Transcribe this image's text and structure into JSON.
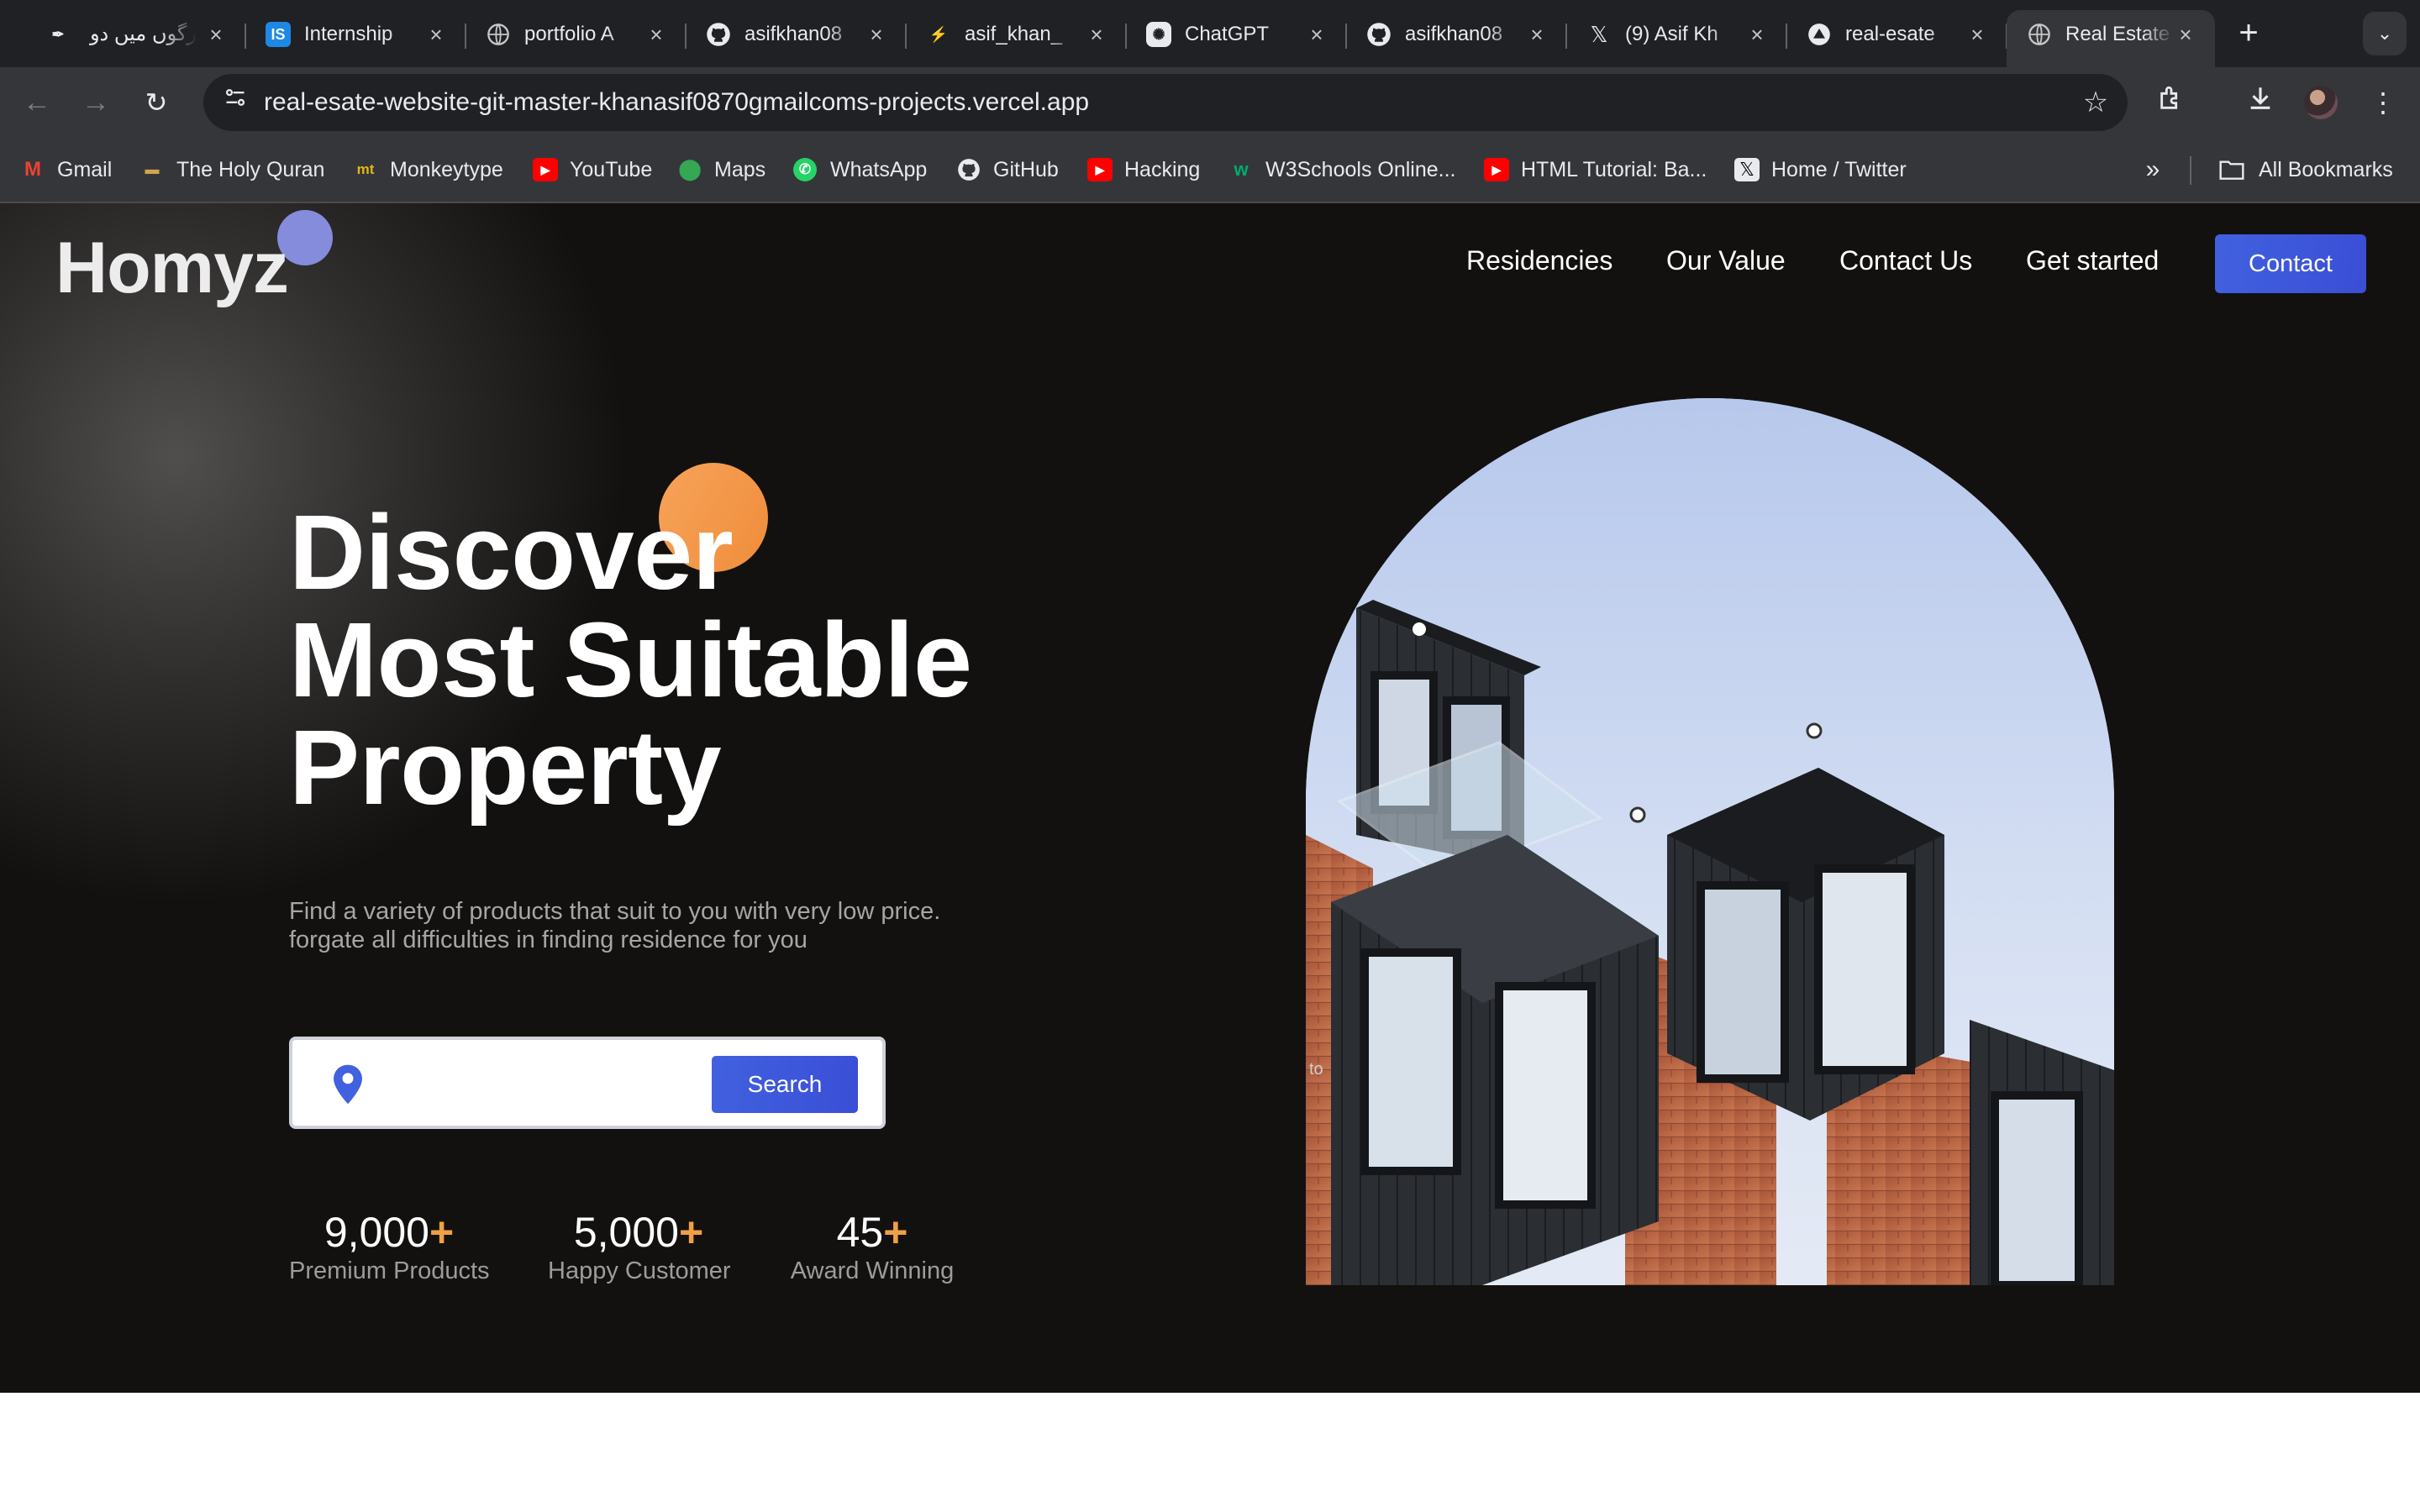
{
  "browser": {
    "tabs": [
      {
        "title": "رگوں میں دو",
        "icon": "pinned-site-icon",
        "active": false
      },
      {
        "title": "Internship",
        "icon": "internshala-icon",
        "active": false
      },
      {
        "title": "portfolio A",
        "icon": "globe-icon",
        "active": false
      },
      {
        "title": "asifkhan08",
        "icon": "github-icon",
        "active": false
      },
      {
        "title": "asif_khan_",
        "icon": "spark-icon",
        "active": false
      },
      {
        "title": "ChatGPT",
        "icon": "chatgpt-icon",
        "active": false
      },
      {
        "title": "asifkhan08",
        "icon": "github-icon",
        "active": false
      },
      {
        "title": "(9) Asif Kh",
        "icon": "x-icon",
        "active": false
      },
      {
        "title": "real-esate",
        "icon": "vercel-icon",
        "active": false
      },
      {
        "title": "Real Estate",
        "icon": "globe-icon",
        "active": true
      }
    ],
    "new_tab": "+",
    "url": "real-esate-website-git-master-khanasif0870gmailcoms-projects.vercel.app",
    "bookmarks": [
      {
        "label": "Gmail",
        "icon": "gmail-icon"
      },
      {
        "label": "The Holy Quran",
        "icon": "quran-icon"
      },
      {
        "label": "Monkeytype",
        "icon": "monkeytype-icon"
      },
      {
        "label": "YouTube",
        "icon": "youtube-icon"
      },
      {
        "label": "Maps",
        "icon": "maps-pin-icon"
      },
      {
        "label": "WhatsApp",
        "icon": "whatsapp-icon"
      },
      {
        "label": "GitHub",
        "icon": "github-icon"
      },
      {
        "label": "Hacking",
        "icon": "youtube-icon"
      },
      {
        "label": "W3Schools Online...",
        "icon": "w3schools-icon"
      },
      {
        "label": "HTML Tutorial: Ba...",
        "icon": "youtube-icon"
      },
      {
        "label": "Home / Twitter",
        "icon": "x-icon"
      }
    ],
    "all_bookmarks": "All Bookmarks"
  },
  "page": {
    "logo": "Homyz",
    "nav": [
      "Residencies",
      "Our Value",
      "Contact Us",
      "Get started"
    ],
    "contact_button": "Contact",
    "headline": [
      "Discover",
      "Most Suitable",
      "Property"
    ],
    "subtext": [
      "Find a variety of products that suit to you with very low price.",
      "forgate all difficulties in finding residence for you"
    ],
    "search": {
      "placeholder": "",
      "button": "Search"
    },
    "stats": [
      {
        "number": "9,000",
        "suffix": "+",
        "label": "Premium Products"
      },
      {
        "number": "5,000",
        "suffix": "+",
        "label": "Happy Customer"
      },
      {
        "number": "45",
        "suffix": "+",
        "label": "Award Winning"
      }
    ],
    "image_overlay_text": "to",
    "colors": {
      "accent": "#4161df",
      "highlight": "#f0a044",
      "background": "#131110"
    }
  }
}
